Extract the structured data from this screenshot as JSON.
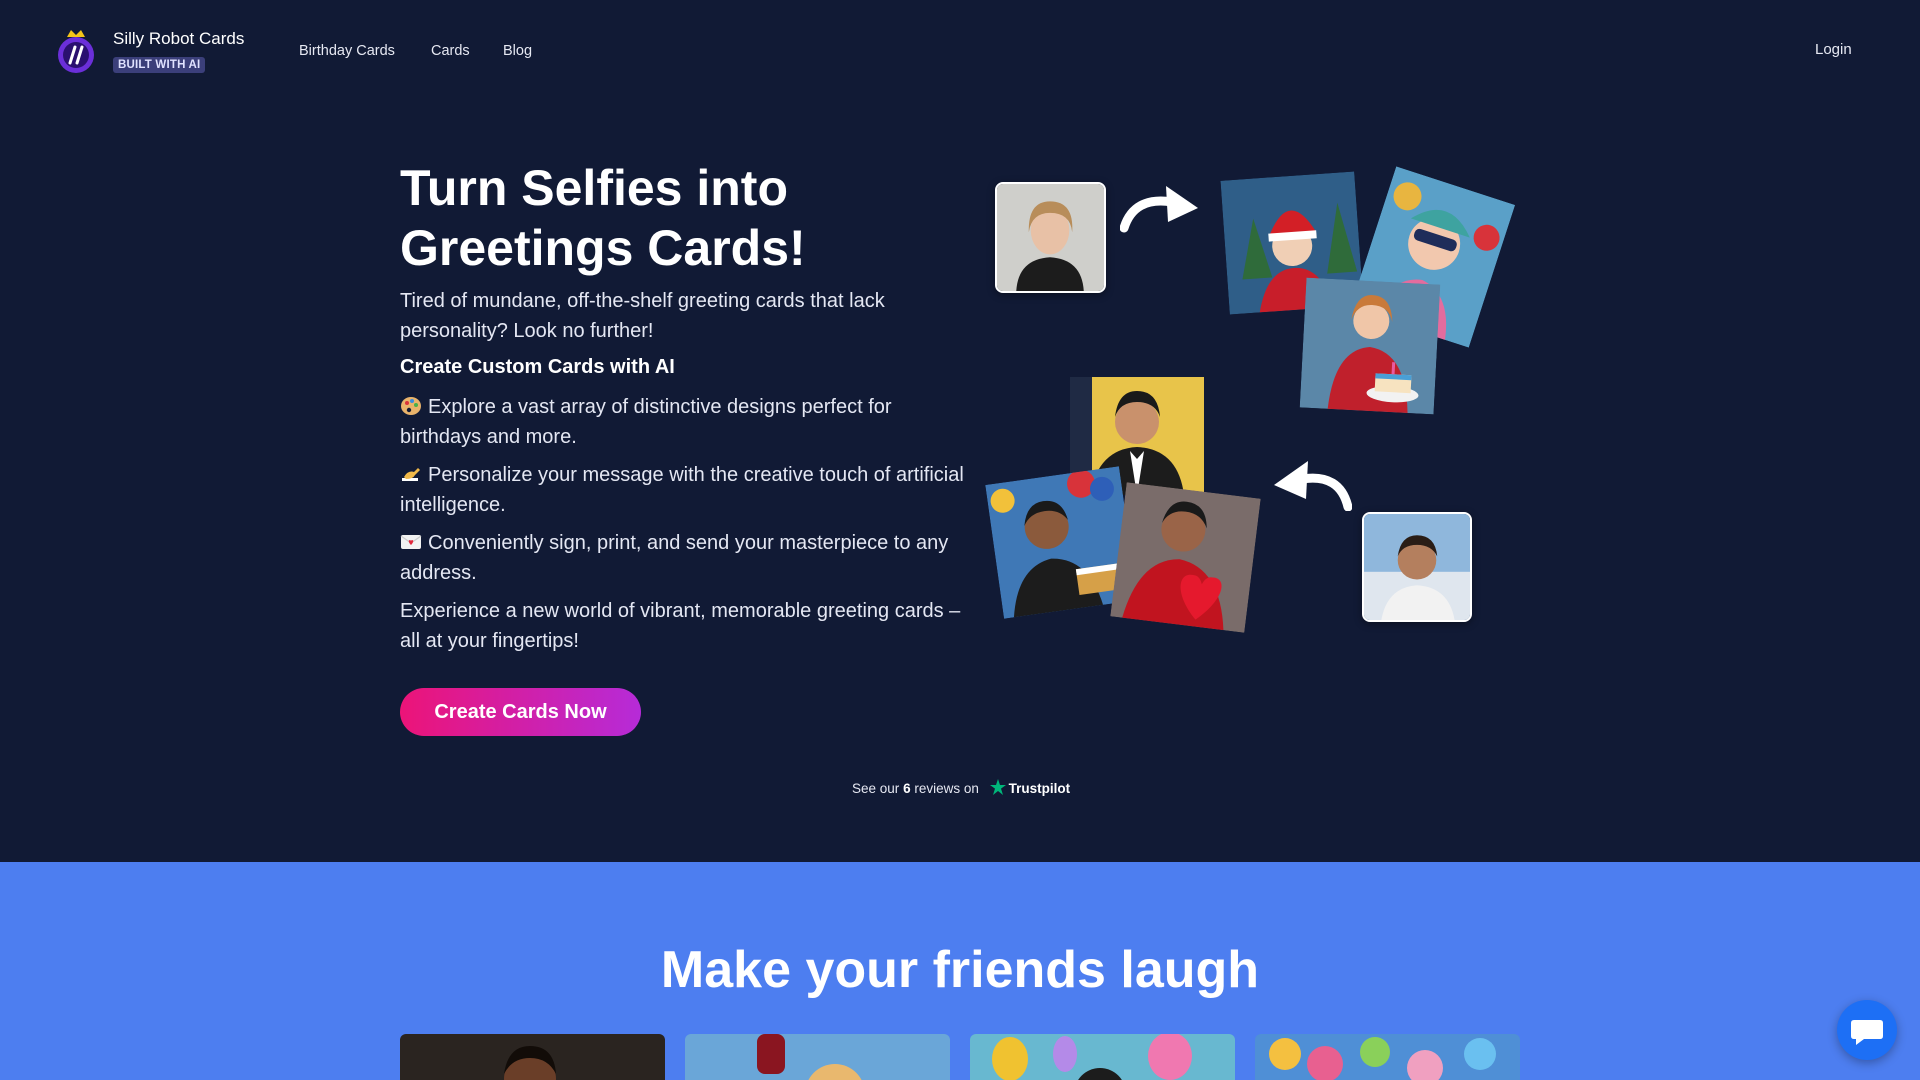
{
  "header": {
    "brand": "Silly Robot Cards",
    "badge": "BUILT WITH AI",
    "nav": [
      "Birthday Cards",
      "Cards",
      "Blog"
    ],
    "login": "Login"
  },
  "hero": {
    "title": "Turn Selfies into Greetings Cards!",
    "intro": "Tired of mundane, off-the-shelf greeting cards that lack personality? Look no further!",
    "subheading": "Create Custom Cards with AI",
    "bullets": [
      {
        "icon": "palette-icon",
        "text": "Explore a vast array of distinctive designs perfect for birthdays and more."
      },
      {
        "icon": "writing-hand-icon",
        "text": "Personalize your message with the creative touch of artificial intelligence."
      },
      {
        "icon": "envelope-icon",
        "text": "Conveniently sign, print, and send your masterpiece to any address."
      }
    ],
    "closing": "Experience a new world of vibrant, memorable greeting cards – all at your fingertips!",
    "cta": "Create Cards Now"
  },
  "trustpilot": {
    "prefix": "See our",
    "count": "6",
    "suffix": "reviews on",
    "brand": "Trustpilot"
  },
  "section": {
    "heading": "Make your friends laugh"
  },
  "colors": {
    "background": "#111a35",
    "section_blue": "#4d7ef0",
    "cta_start": "#ec1478",
    "cta_end": "#b62bd8",
    "trustpilot_green": "#00b67a",
    "chat_button": "#1d6ff5"
  }
}
